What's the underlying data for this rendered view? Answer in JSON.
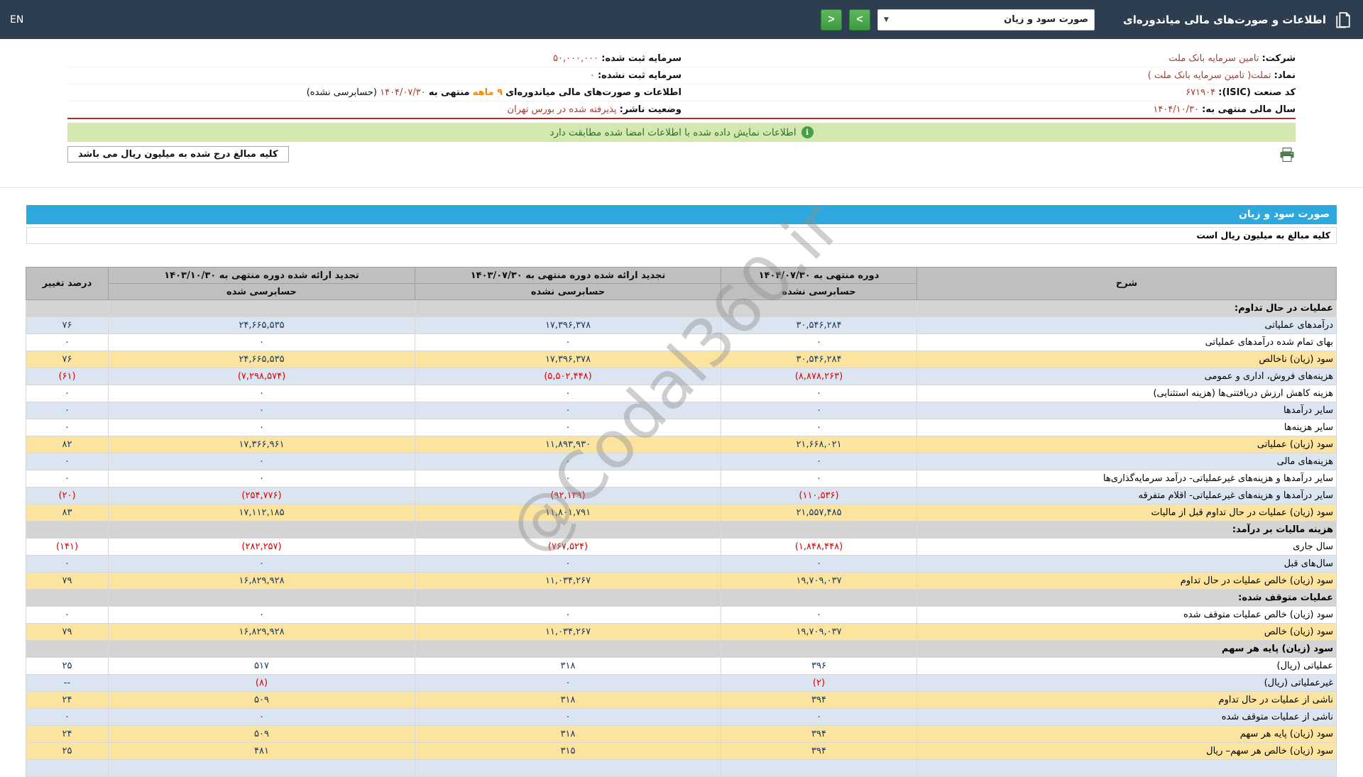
{
  "header": {
    "title": "اطلاعات و صورت‌های مالی میاندوره‌ای",
    "statement_select": "صورت سود و زیان",
    "nav_forward": ">",
    "nav_back": "<",
    "language": "EN"
  },
  "company": {
    "right": [
      {
        "label": "شرکت:",
        "value": "تامین سرمایه بانک ملت"
      },
      {
        "label": "نماد:",
        "value": "تملت( تامین سرمایه بانک ملت )"
      },
      {
        "label": "کد صنعت (ISIC):",
        "value": "۶۷۱۹۰۴"
      },
      {
        "label": "سال مالی منتهی به:",
        "value": "۱۴۰۴/۱۰/۳۰"
      }
    ],
    "left": [
      {
        "label": "سرمایه ثبت شده:",
        "value": "۵۰,۰۰۰,۰۰۰"
      },
      {
        "label": "سرمایه ثبت نشده:",
        "value": "۰"
      },
      {
        "label": "اطلاعات و صورت‌های مالی میاندوره‌ای",
        "months": "۹ ماهه",
        "mid": "منتهی به",
        "date": "۱۴۰۴/۰۷/۳۰",
        "suffix": "(حسابرسی نشده)"
      },
      {
        "label": "وضعیت ناشر:",
        "value": "پذیرفته شده در بورس تهران"
      }
    ]
  },
  "notices": {
    "signed_match": "اطلاعات نمایش داده شده با اطلاعات امضا شده مطابقت دارد",
    "amounts_note_box": "کلیه مبالغ درج شده به میلیون ریال می باشد"
  },
  "statement": {
    "title": "صورت سود و زیان",
    "amounts_note": "کلیه مبالغ به میلیون ریال است",
    "columns": {
      "desc": "شرح",
      "current": "دوره منتهی به ۱۴۰۴/۰۷/۳۰",
      "current_audit": "حسابرسی نشده",
      "restated_interim": "تجدید ارائه شده دوره منتهی به ۱۴۰۳/۰۷/۳۰",
      "restated_interim_audit": "حسابرسی نشده",
      "restated_annual": "تجدید ارائه شده دوره منتهی به ۱۴۰۳/۱۰/۳۰",
      "restated_annual_audit": "حسابرسی شده",
      "pct": "درصد تغییر"
    },
    "rows": [
      {
        "type": "section",
        "desc": "عملیات در حال تداوم:"
      },
      {
        "type": "data",
        "tone": "blue",
        "desc": "درآمدهای عملیاتی",
        "v1": "۳۰,۵۴۶,۲۸۴",
        "v2": "۱۷,۳۹۶,۳۷۸",
        "v3": "۲۴,۶۶۵,۵۳۵",
        "pct": "۷۶"
      },
      {
        "type": "data",
        "tone": "white",
        "desc": "بهای تمام شده درآمدهای عملیاتی",
        "v1": "۰",
        "v2": "۰",
        "v3": "۰",
        "pct": "۰"
      },
      {
        "type": "data",
        "tone": "yellow",
        "desc": "سود (زیان) ناخالص",
        "v1": "۳۰,۵۴۶,۲۸۴",
        "v2": "۱۷,۳۹۶,۳۷۸",
        "v3": "۲۴,۶۶۵,۵۳۵",
        "pct": "۷۶"
      },
      {
        "type": "data",
        "tone": "blue",
        "desc": "هزینه‌های فروش، اداری و عمومی",
        "v1": "(۸,۸۷۸,۲۶۳)",
        "v2": "(۵,۵۰۲,۴۴۸)",
        "v3": "(۷,۲۹۸,۵۷۴)",
        "pct": "(۶۱)"
      },
      {
        "type": "data",
        "tone": "white",
        "desc": "هزینه کاهش ارزش دریافتنی‌ها (هزینه استثنایی)",
        "v1": "۰",
        "v2": "۰",
        "v3": "۰",
        "pct": "۰"
      },
      {
        "type": "data",
        "tone": "blue",
        "desc": "سایر درآمدها",
        "v1": "۰",
        "v2": "۰",
        "v3": "۰",
        "pct": "۰"
      },
      {
        "type": "data",
        "tone": "white",
        "desc": "سایر هزینه‌ها",
        "v1": "۰",
        "v2": "۰",
        "v3": "۰",
        "pct": "۰"
      },
      {
        "type": "data",
        "tone": "yellow",
        "desc": "سود (زیان) عملیاتی",
        "v1": "۲۱,۶۶۸,۰۲۱",
        "v2": "۱۱,۸۹۳,۹۳۰",
        "v3": "۱۷,۳۶۶,۹۶۱",
        "pct": "۸۲"
      },
      {
        "type": "data",
        "tone": "blue",
        "desc": "هزینه‌های مالی",
        "v1": "۰",
        "v2": "۰",
        "v3": "۰",
        "pct": "۰"
      },
      {
        "type": "data",
        "tone": "white",
        "desc": "سایر درآمدها و هزینه‌های غیرعملیاتی- درآمد سرمایه‌گذاری‌ها",
        "v1": "۰",
        "v2": "۰",
        "v3": "۰",
        "pct": "۰"
      },
      {
        "type": "data",
        "tone": "blue",
        "desc": "سایر درآمدها و هزینه‌های غیرعملیاتی- اقلام متفرقه",
        "v1": "(۱۱۰,۵۳۶)",
        "v2": "(۹۲,۱۳۹)",
        "v3": "(۲۵۴,۷۷۶)",
        "pct": "(۲۰)"
      },
      {
        "type": "data",
        "tone": "yellow",
        "desc": "سود (زیان) عملیات در حال تداوم قبل از مالیات",
        "v1": "۲۱,۵۵۷,۴۸۵",
        "v2": "۱۱,۸۰۱,۷۹۱",
        "v3": "۱۷,۱۱۲,۱۸۵",
        "pct": "۸۳"
      },
      {
        "type": "section",
        "desc": "هزینه مالیات بر درآمد:"
      },
      {
        "type": "data",
        "tone": "white",
        "desc": "سال جاری",
        "v1": "(۱,۸۴۸,۴۴۸)",
        "v2": "(۷۶۷,۵۲۴)",
        "v3": "(۲۸۲,۲۵۷)",
        "pct": "(۱۴۱)"
      },
      {
        "type": "data",
        "tone": "blue",
        "desc": "سال‌های قبل",
        "v1": "۰",
        "v2": "۰",
        "v3": "۰",
        "pct": "۰"
      },
      {
        "type": "data",
        "tone": "yellow",
        "desc": "سود (زیان) خالص عملیات در حال تداوم",
        "v1": "۱۹,۷۰۹,۰۳۷",
        "v2": "۱۱,۰۳۴,۲۶۷",
        "v3": "۱۶,۸۲۹,۹۲۸",
        "pct": "۷۹"
      },
      {
        "type": "section",
        "desc": "عملیات متوقف شده:"
      },
      {
        "type": "data",
        "tone": "white",
        "desc": "سود (زیان) خالص عملیات متوقف شده",
        "v1": "۰",
        "v2": "۰",
        "v3": "۰",
        "pct": "۰"
      },
      {
        "type": "data",
        "tone": "yellow",
        "desc": "سود (زیان) خالص",
        "v1": "۱۹,۷۰۹,۰۳۷",
        "v2": "۱۱,۰۳۴,۲۶۷",
        "v3": "۱۶,۸۲۹,۹۲۸",
        "pct": "۷۹"
      },
      {
        "type": "section",
        "desc": "سود (زیان) پایه هر سهم"
      },
      {
        "type": "data",
        "tone": "white",
        "desc": "عملیاتی (ریال)",
        "v1": "۳۹۶",
        "v2": "۳۱۸",
        "v3": "۵۱۷",
        "pct": "۲۵"
      },
      {
        "type": "data",
        "tone": "blue",
        "desc": "غیرعملیاتی (ریال)",
        "v1": "(۲)",
        "v2": "۰",
        "v3": "(۸)",
        "pct": "--"
      },
      {
        "type": "data",
        "tone": "yellow",
        "desc": "ناشی از عملیات در حال تداوم",
        "v1": "۳۹۴",
        "v2": "۳۱۸",
        "v3": "۵۰۹",
        "pct": "۲۴"
      },
      {
        "type": "data",
        "tone": "blue",
        "desc": "ناشی از عملیات متوقف شده",
        "v1": "۰",
        "v2": "۰",
        "v3": "۰",
        "pct": "۰"
      },
      {
        "type": "data",
        "tone": "yellow",
        "desc": "سود (زیان) پایه هر سهم",
        "v1": "۳۹۴",
        "v2": "۳۱۸",
        "v3": "۵۰۹",
        "pct": "۲۴"
      },
      {
        "type": "data",
        "tone": "yellow",
        "desc": "سود (زیان) خالص هر سهم– ریال",
        "v1": "۳۹۴",
        "v2": "۳۱۵",
        "v3": "۴۸۱",
        "pct": "۲۵"
      },
      {
        "type": "data",
        "tone": "blue",
        "desc": "",
        "v1": "",
        "v2": "",
        "v3": "",
        "pct": ""
      }
    ]
  },
  "watermark": "@Codal360.ir",
  "colors": {
    "topbar": "#2d3e50",
    "accent_blue": "#2ea9dd",
    "row_blue": "#dbe5f1",
    "highlight_yellow": "#fce49e",
    "section_gray": "#d4d4d4",
    "negative_red": "#dd0000",
    "value_maroon": "#a63d33",
    "notice_green_bg": "#d2e8ae"
  }
}
